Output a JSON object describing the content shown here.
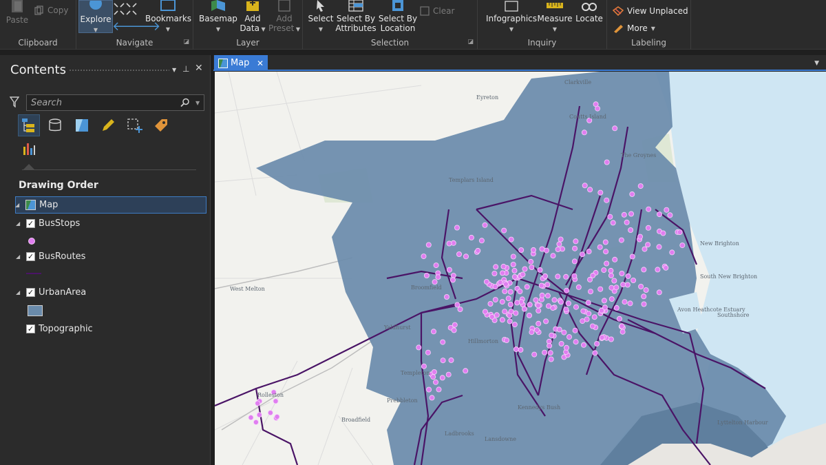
{
  "ribbon": {
    "clipboard": {
      "label": "Clipboard",
      "paste": "Paste",
      "copy": "Copy"
    },
    "navigate": {
      "label": "Navigate",
      "explore": "Explore",
      "bookmarks": "Bookmarks"
    },
    "layer": {
      "label": "Layer",
      "basemap": "Basemap",
      "add_data_line1": "Add",
      "add_data_line2": "Data",
      "add_preset_line1": "Add",
      "add_preset_line2": "Preset"
    },
    "selection": {
      "label": "Selection",
      "select": "Select",
      "select_by_attr_line1": "Select By",
      "select_by_attr_line2": "Attributes",
      "select_by_loc_line1": "Select By",
      "select_by_loc_line2": "Location",
      "clear": "Clear"
    },
    "inquiry": {
      "label": "Inquiry",
      "infographics": "Infographics",
      "measure": "Measure",
      "locate": "Locate"
    },
    "labeling": {
      "label": "Labeling",
      "view_unplaced": "View Unplaced",
      "more": "More"
    }
  },
  "contents": {
    "title": "Contents",
    "search_placeholder": "Search",
    "drawing_order": "Drawing Order",
    "map_node": "Map",
    "layers": [
      {
        "name": "BusStops"
      },
      {
        "name": "BusRoutes"
      },
      {
        "name": "UrbanArea"
      },
      {
        "name": "Topographic"
      }
    ]
  },
  "map_tab": {
    "label": "Map"
  },
  "map_labels": {
    "clarkville": "Clarkville",
    "eyreton": "Eyreton",
    "coutts_island": "Coutts Island",
    "the_groynes": "The Groynes",
    "templars_island": "Templars Island",
    "new_brighton": "New Brighton",
    "south_new_brighton": "South New Brighton",
    "southshore": "Southshore",
    "west_melton": "West Melton",
    "broomfield": "Broomfield",
    "hillmorton": "Hillmorton",
    "yaldhurst": "Yaldhurst",
    "templeton": "Templeton",
    "kennedys_bush": "Kennedys Bush",
    "broadfield": "Broadfield",
    "ladbrooks": "Ladbrooks",
    "lansdowne": "Lansdowne",
    "avon_heathcote": "Avon Heathcote Estuary",
    "lyttelton": "Lyttelton Harbour",
    "rolleston": "Rolleston",
    "prebbleton": "Prebbleton"
  },
  "colors": {
    "urban_area": "#6a8bab",
    "bus_route": "#4a1466",
    "bus_stop": "#e07ef0",
    "water": "#cfe6f3",
    "accent": "#3a7bd5"
  }
}
